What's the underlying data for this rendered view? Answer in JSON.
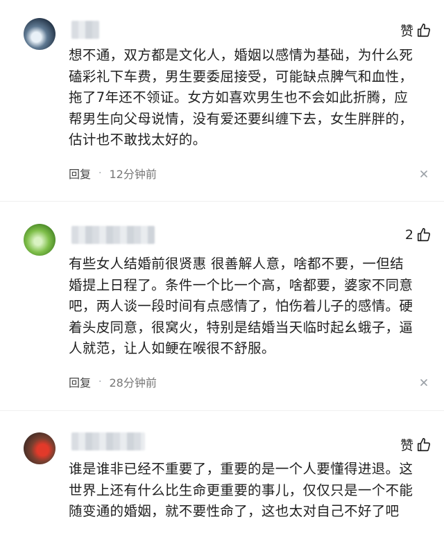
{
  "comments": [
    {
      "like_label": "赞",
      "text": "想不通，双方都是文化人，婚姻以感情为基础，为什么死\n磕彩礼下车费，男生要委屈接受，可能缺点脾气和血性，\n拖了7年还不领证。女方如喜欢男生也不会如此折腾，应\n帮男生向父母说情，没有爱还要纠缠下去，女生胖胖的，\n估计也不敢找太好的。",
      "reply_label": "回复",
      "time": "12分钟前"
    },
    {
      "like_label": "2",
      "text": "有些女人结婚前很贤惠 很善解人意，啥都不要，一但结\n婚提上日程了。条件一个比一个高，啥都要，婆家不同意\n吧，两人谈一段时间有点感情了，怕伤着儿子的感情。硬\n着头皮同意，很窝火，特别是结婚当天临时起幺蛾子，逼\n人就范，让人如鲠在喉很不舒服。",
      "reply_label": "回复",
      "time": "28分钟前"
    },
    {
      "like_label": "赞",
      "text": "谁是谁非已经不重要了，重要的是一个人要懂得进退。这\n世界上还有什么比生命更重要的事儿，仅仅只是一个不能\n随变通的婚姻，就不要性命了，这也太对自己不好了吧"
    }
  ]
}
